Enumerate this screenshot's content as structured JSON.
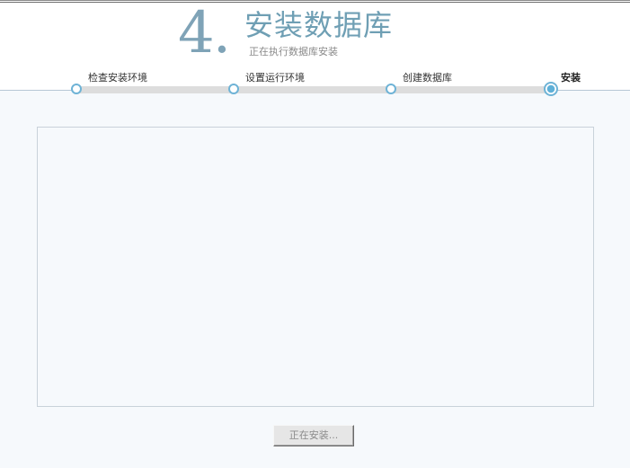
{
  "header": {
    "step_number": "4.",
    "title": "安装数据库",
    "subtitle": "正在执行数据库安装"
  },
  "progress": {
    "steps": [
      {
        "label": "检查安装环境",
        "state": "done"
      },
      {
        "label": "设置运行环境",
        "state": "done"
      },
      {
        "label": "创建数据库",
        "state": "done"
      },
      {
        "label": "安装",
        "state": "current"
      }
    ]
  },
  "log": {
    "content": ""
  },
  "footer": {
    "install_button_label": "正在安装..."
  },
  "colors": {
    "accent": "#6eb3d6",
    "title": "#6f9fb4",
    "background": "#f6f9fc"
  }
}
